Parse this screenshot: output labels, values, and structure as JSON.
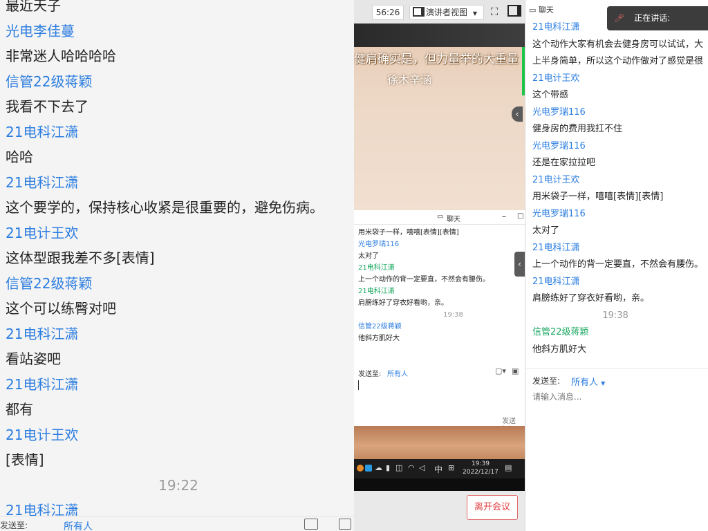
{
  "left_chat": {
    "header_partial": "最近天子",
    "messages": [
      {
        "type": "name",
        "text": "光电李佳蔓"
      },
      {
        "type": "text",
        "text": "非常迷人哈哈哈哈"
      },
      {
        "type": "name",
        "text": "信管22级蒋颖"
      },
      {
        "type": "text",
        "text": "我看不下去了"
      },
      {
        "type": "name",
        "text": "21电科江潇"
      },
      {
        "type": "text",
        "text": "哈哈"
      },
      {
        "type": "name",
        "text": "21电科江潇"
      },
      {
        "type": "text",
        "text": "这个要学的，保持核心收紧是很重要的，避免伤病。"
      },
      {
        "type": "name",
        "text": "21电计王欢"
      },
      {
        "type": "text",
        "text": "这体型跟我差不多[表情]"
      },
      {
        "type": "name",
        "text": "信管22级蒋颖"
      },
      {
        "type": "text",
        "text": "这个可以练臀对吧"
      },
      {
        "type": "name",
        "text": "21电科江潇"
      },
      {
        "type": "text",
        "text": "看站姿吧"
      },
      {
        "type": "name",
        "text": "21电科江潇"
      },
      {
        "type": "text",
        "text": "都有"
      },
      {
        "type": "name",
        "text": "21电计王欢"
      },
      {
        "type": "text",
        "text": "[表情]"
      },
      {
        "type": "time",
        "text": "19:22"
      },
      {
        "type": "name",
        "text": "21电科江潇"
      }
    ],
    "send_to_label": "发送至:",
    "send_to_value": "所有人"
  },
  "toolbar": {
    "timer": "56:26",
    "view_label": "演讲者视图"
  },
  "video": {
    "caption_line1": "健肩确实是，但力量举的大重量",
    "caption_line2": "徐木辛涵"
  },
  "mini_chat": {
    "title": "聊天",
    "lines": [
      {
        "cls": "",
        "text": "用米袋子一样，嘻嘻[表情][表情]"
      },
      {
        "cls": "n",
        "text": "光电罗瑞116"
      },
      {
        "cls": "",
        "text": "太对了"
      },
      {
        "cls": "g",
        "text": "21电科江潇"
      },
      {
        "cls": "",
        "text": "上一个动作的背一定要直，不然会有腰伤。"
      },
      {
        "cls": "g",
        "text": "21电科江潇"
      },
      {
        "cls": "",
        "text": "肩膀练好了穿衣好看哟，亲。"
      },
      {
        "cls": "t",
        "text": "19:38"
      },
      {
        "cls": "n",
        "text": "信管22级蒋颖"
      },
      {
        "cls": "",
        "text": "他斜方肌好大"
      }
    ],
    "send_to_label": "发送至:",
    "send_to_value": "所有人",
    "send_button": "发送(S)"
  },
  "taskbar": {
    "ime": "中",
    "time": "19:39",
    "date": "2022/12/17"
  },
  "leave_button": "离开会议",
  "right_chat": {
    "title": "聊天",
    "speaking_label": "正在讲话:",
    "messages": [
      {
        "cls": "n",
        "text": "21电科江潇"
      },
      {
        "cls": "t",
        "text": "这个动作大家有机会去健身房可以试试，大"
      },
      {
        "cls": "t",
        "text": "上半身简单，所以这个动作做对了感觉是很"
      },
      {
        "cls": "n",
        "text": "21电计王欢"
      },
      {
        "cls": "t",
        "text": "这个带感"
      },
      {
        "cls": "n",
        "text": "光电罗瑞116"
      },
      {
        "cls": "t",
        "text": "健身房的费用我扛不住"
      },
      {
        "cls": "n",
        "text": "光电罗瑞116"
      },
      {
        "cls": "t",
        "text": "还是在家拉拉吧"
      },
      {
        "cls": "n",
        "text": "21电计王欢"
      },
      {
        "cls": "t",
        "text": "用米袋子一样，嘻嘻[表情][表情]"
      },
      {
        "cls": "n",
        "text": "光电罗瑞116"
      },
      {
        "cls": "t",
        "text": "太对了"
      },
      {
        "cls": "n",
        "text": "21电科江潇"
      },
      {
        "cls": "t",
        "text": "上一个动作的背一定要直，不然会有腰伤。"
      },
      {
        "cls": "n",
        "text": "21电科江潇"
      },
      {
        "cls": "t",
        "text": "肩膀练好了穿衣好看哟，亲。"
      },
      {
        "cls": "tm",
        "text": "19:38"
      },
      {
        "cls": "g",
        "text": "信管22级蒋颖"
      },
      {
        "cls": "t",
        "text": "他斜方肌好大"
      }
    ],
    "send_to_label": "发送至:",
    "send_to_value": "所有人",
    "input_placeholder": "请输入消息..."
  }
}
